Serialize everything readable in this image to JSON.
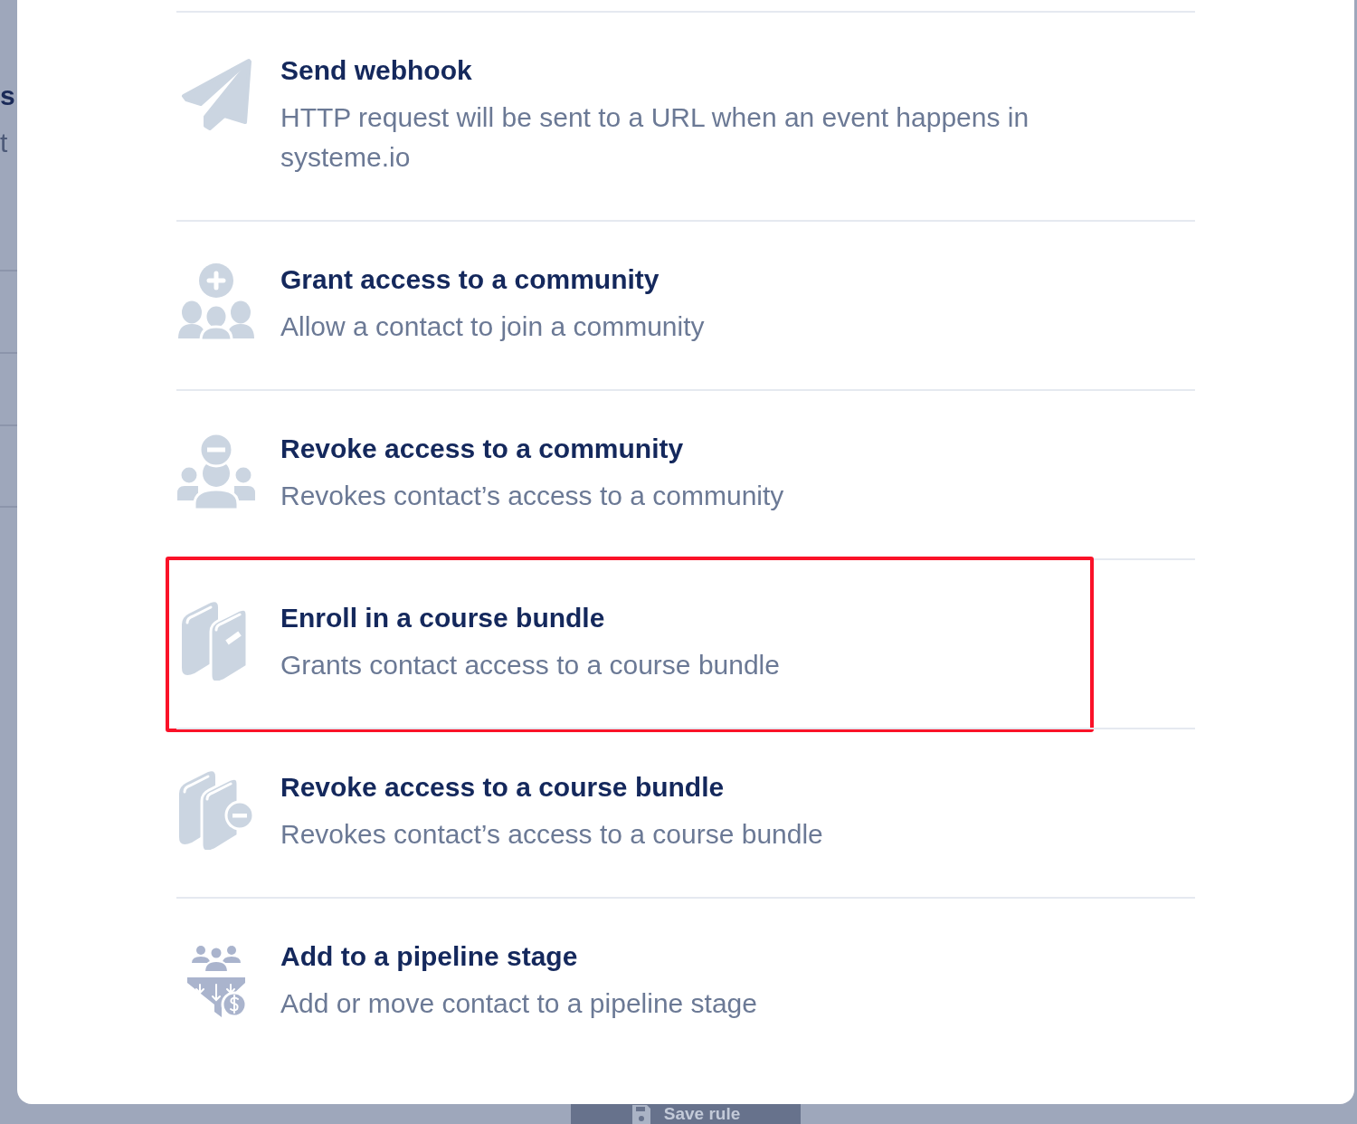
{
  "background_page": {
    "fragments": [
      {
        "kind": "title",
        "text": "s"
      },
      {
        "kind": "body",
        "text": "t"
      }
    ],
    "save_button": {
      "label": "Save rule"
    }
  },
  "actions": [
    {
      "title": "Send webhook",
      "description": "HTTP request will be sent to a URL when an event happens in systeme.io",
      "highlighted": false
    },
    {
      "title": "Grant access to a community",
      "description": "Allow a contact to join a community",
      "highlighted": false
    },
    {
      "title": "Revoke access to a community",
      "description": "Revokes contact’s access to a community",
      "highlighted": false
    },
    {
      "title": "Enroll in a course bundle",
      "description": "Grants contact access to a course bundle",
      "highlighted": true
    },
    {
      "title": "Revoke access to a course bundle",
      "description": "Revokes contact’s access to a course bundle",
      "highlighted": false
    },
    {
      "title": "Add to a pipeline stage",
      "description": "Add or move contact to a pipeline stage",
      "highlighted": false
    }
  ]
}
